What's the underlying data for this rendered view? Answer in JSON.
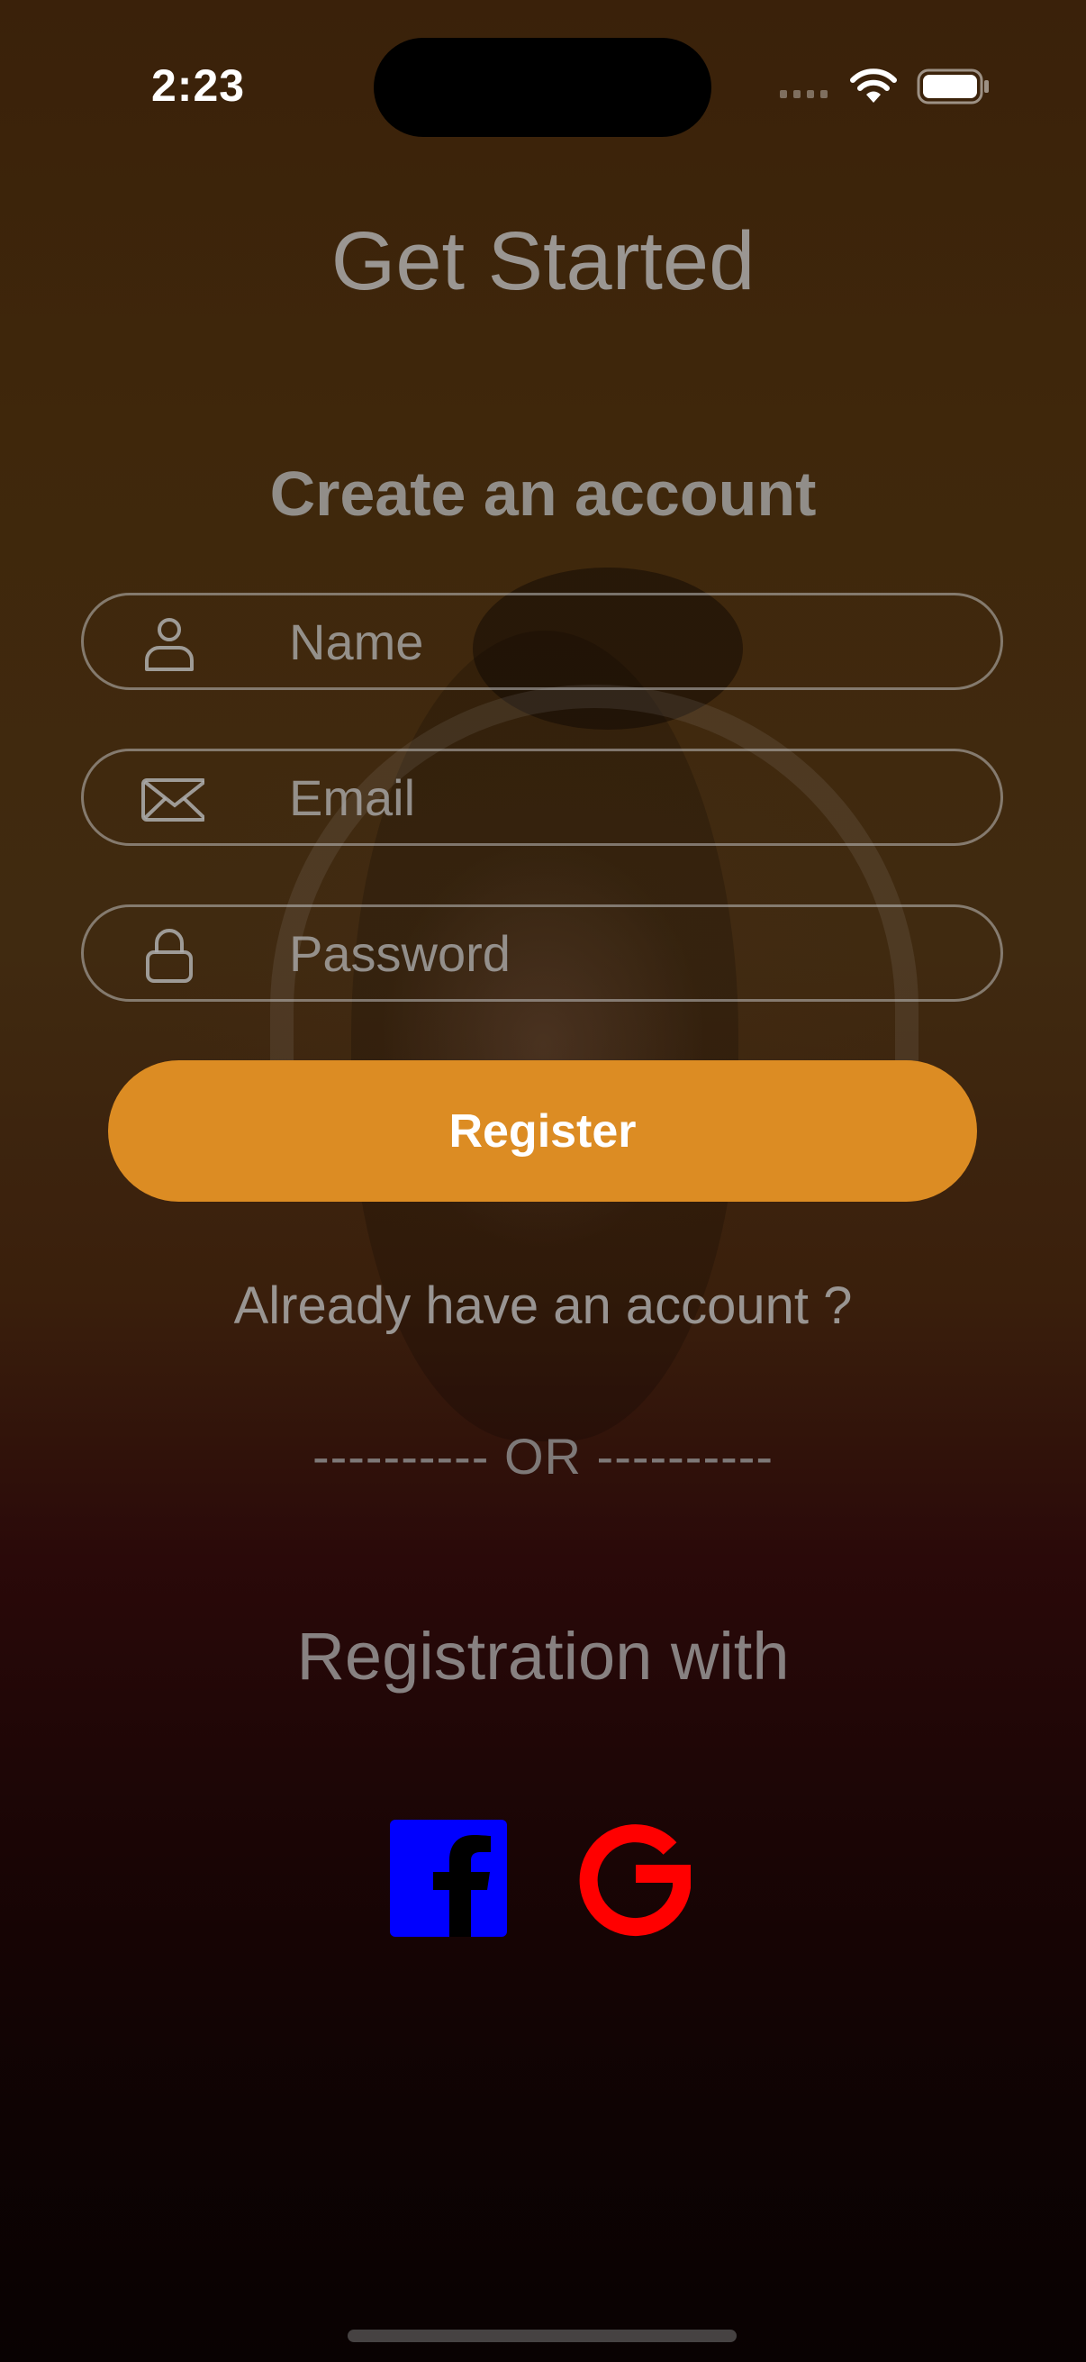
{
  "status_bar": {
    "time": "2:23"
  },
  "screen": {
    "title": "Get Started",
    "subtitle": "Create an account"
  },
  "form": {
    "name_placeholder": "Name",
    "email_placeholder": "Email",
    "password_placeholder": "Password",
    "register_label": "Register"
  },
  "links": {
    "login_text": "Already have an account ?"
  },
  "divider_text": "---------- OR ----------",
  "social": {
    "heading": "Registration with",
    "providers": [
      {
        "name": "facebook",
        "icon": "facebook-icon",
        "color": "#0000ff"
      },
      {
        "name": "google",
        "icon": "google-icon",
        "color": "#ff0000"
      }
    ]
  },
  "colors": {
    "accent": "#dc8c23"
  }
}
